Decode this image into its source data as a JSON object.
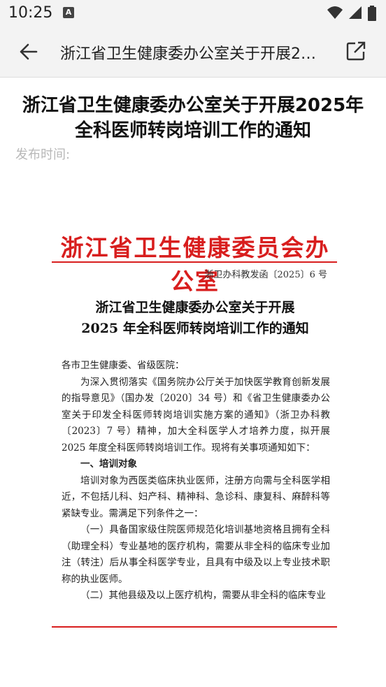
{
  "status_bar": {
    "time": "10:25",
    "app_icon": "A",
    "icons": [
      "wifi-icon",
      "signal-icon",
      "battery-icon"
    ]
  },
  "toolbar": {
    "back_icon": "arrow-left-icon",
    "title": "浙江省卫生健康委办公室关于开展2…",
    "open_icon": "open-external-icon"
  },
  "article": {
    "title_line1": "浙江省卫生健康委办公室关于开展2025年",
    "title_line2": "全科医师转岗培训工作的通知",
    "publish_label": "发布时间:"
  },
  "document": {
    "header": "浙江省卫生健康委员会办公室",
    "number": "浙卫办科教发函〔2025〕6 号",
    "title_line1": "浙江省卫生健康委办公室关于开展",
    "title_line2": "2025 年全科医师转岗培训工作的通知",
    "salutation": "各市卫生健康委、省级医院：",
    "para1": "为深入贯彻落实《国务院办公厅关于加快医学教育创新发展的指导意见》（国办发〔2020〕34 号）和《省卫生健康委办公室关于印发全科医师转岗培训实施方案的通知》（浙卫办科教〔2023〕7 号）精神，加大全科医学人才培养力度，拟开展 2025 年度全科医师转岗培训工作。现将有关事项通知如下：",
    "section1": "一、培训对象",
    "para2": "培训对象为西医类临床执业医师，注册方向需与全科医学相近，不包括儿科、妇产科、精神科、急诊科、康复科、麻醉科等紧缺专业。需满足下列条件之一：",
    "item1": "（一）具备国家级住院医师规范化培训基地资格且拥有全科（助理全科）专业基地的医疗机构，需要从非全科的临床专业加注（转注）后从事全科医学专业，且具有中级及以上专业技术职称的执业医师。",
    "item2": "（二）其他县级及以上医疗机构，需要从非全科的临床专业"
  },
  "colors": {
    "doc_red": "#d81e1e",
    "bar_bg": "#f3f3f3"
  }
}
